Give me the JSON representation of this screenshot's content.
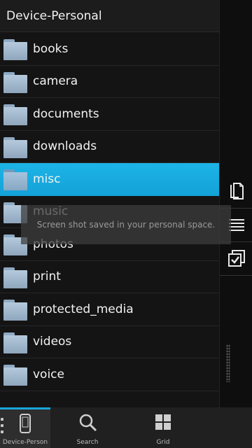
{
  "header": {
    "title": "Device-Personal"
  },
  "folders": [
    {
      "label": "books"
    },
    {
      "label": "camera"
    },
    {
      "label": "documents"
    },
    {
      "label": "downloads"
    },
    {
      "label": "misc",
      "selected": true
    },
    {
      "label": "music"
    },
    {
      "label": "photos"
    },
    {
      "label": "print"
    },
    {
      "label": "protected_media"
    },
    {
      "label": "videos"
    },
    {
      "label": "voice"
    }
  ],
  "toast": {
    "message": "Screen shot saved in your personal space."
  },
  "actions": [
    {
      "icon": "copy-document-icon"
    },
    {
      "icon": "list-view-icon"
    },
    {
      "icon": "select-items-icon"
    }
  ],
  "bottom_nav": [
    {
      "label": "Device-Person",
      "icon": "device-icon",
      "active": true
    },
    {
      "label": "Search",
      "icon": "search-icon"
    },
    {
      "label": "Grid",
      "icon": "grid-icon"
    }
  ],
  "colors": {
    "accent": "#1aa7dd",
    "selected_row": "#13a2d8",
    "background": "#141414"
  }
}
